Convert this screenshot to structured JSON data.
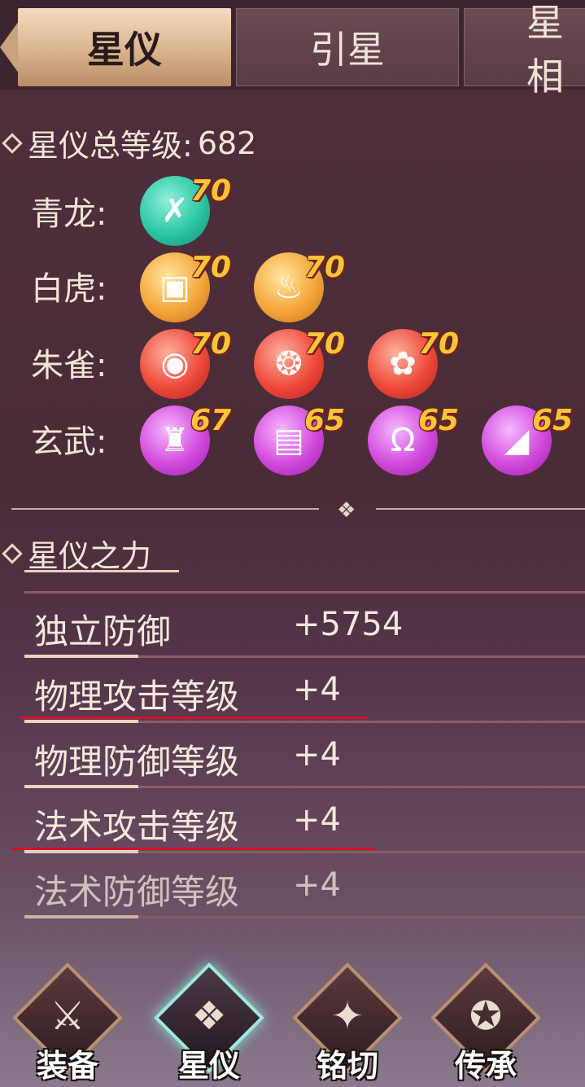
{
  "tabs": [
    {
      "label": "星仪",
      "active": true
    },
    {
      "label": "引星",
      "active": false
    },
    {
      "label": "星相",
      "active": false
    }
  ],
  "summary": {
    "title": "星仪总等级:",
    "total_level": "682"
  },
  "beasts": [
    {
      "label": "青龙:",
      "gems": [
        {
          "icon": "crossed-blades-icon",
          "level": "70",
          "color": "teal",
          "glyph": "✗"
        }
      ]
    },
    {
      "label": "白虎:",
      "gems": [
        {
          "icon": "charm-scroll-icon",
          "level": "70",
          "color": "orange",
          "glyph": "▣"
        },
        {
          "icon": "pouch-icon",
          "level": "70",
          "color": "orange",
          "glyph": "♨"
        }
      ]
    },
    {
      "label": "朱雀:",
      "gems": [
        {
          "icon": "bracelet-icon",
          "level": "70",
          "color": "red",
          "glyph": "◉"
        },
        {
          "icon": "prayer-beads-icon",
          "level": "70",
          "color": "red",
          "glyph": "❂"
        },
        {
          "icon": "flower-icon",
          "level": "70",
          "color": "red",
          "glyph": "✿"
        }
      ]
    },
    {
      "label": "玄武:",
      "gems": [
        {
          "icon": "helmet-icon",
          "level": "67",
          "color": "purple",
          "glyph": "♜"
        },
        {
          "icon": "armor-icon",
          "level": "65",
          "color": "purple",
          "glyph": "▤"
        },
        {
          "icon": "pants-icon",
          "level": "65",
          "color": "purple",
          "glyph": "Ω"
        },
        {
          "icon": "boots-icon",
          "level": "65",
          "color": "purple",
          "glyph": "◢"
        }
      ]
    }
  ],
  "power": {
    "title": "星仪之力",
    "stats": [
      {
        "name": "独立防御",
        "value": "+5754"
      },
      {
        "name": "物理攻击等级",
        "value": "+4"
      },
      {
        "name": "物理防御等级",
        "value": "+4"
      },
      {
        "name": "法术攻击等级",
        "value": "+4"
      },
      {
        "name": "法术防御等级",
        "value": "+4"
      }
    ]
  },
  "nav": [
    {
      "label": "装备",
      "icon": "sword-icon",
      "glyph": "⚔",
      "active": false
    },
    {
      "label": "星仪",
      "icon": "star-instrument-icon",
      "glyph": "❖",
      "active": true
    },
    {
      "label": "铭切",
      "icon": "star-ring-icon",
      "glyph": "✦",
      "active": false
    },
    {
      "label": "传承",
      "icon": "inheritance-icon",
      "glyph": "✪",
      "active": false
    }
  ],
  "colors": {
    "accent_gold": "#f7c53a",
    "underline_red": "#d1122a",
    "active_tab": "#d9b48e"
  }
}
